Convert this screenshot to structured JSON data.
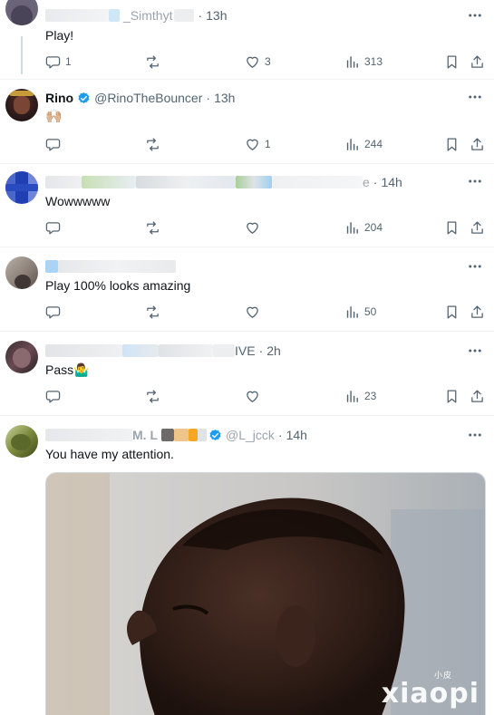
{
  "tweets": [
    {
      "display_name": "",
      "handle": "_Simthyt",
      "time": "13h",
      "text": "Play!",
      "stats": {
        "replies": "1",
        "retweets": "",
        "likes": "3",
        "views": "313"
      }
    },
    {
      "display_name": "Rino",
      "handle": "@RinoTheBouncer",
      "time": "13h",
      "text": "🙌🏼",
      "stats": {
        "replies": "",
        "retweets": "",
        "likes": "1",
        "views": "244"
      }
    },
    {
      "display_name": "",
      "handle": "e",
      "time": "14h",
      "text": "Wowwwww",
      "stats": {
        "replies": "",
        "retweets": "",
        "likes": "",
        "views": "204"
      }
    },
    {
      "display_name": "",
      "handle": "",
      "time": "",
      "text": "Play 100% looks amazing",
      "stats": {
        "replies": "",
        "retweets": "",
        "likes": "",
        "views": "50"
      }
    },
    {
      "display_name": "IVE",
      "handle": "",
      "time": "2h",
      "text": "Pass🤷‍♂️",
      "stats": {
        "replies": "",
        "retweets": "",
        "likes": "",
        "views": "23"
      }
    },
    {
      "display_name": "M. L",
      "handle": "@L_jcck",
      "time": "14h",
      "text": "You have my attention.",
      "stats": {}
    }
  ],
  "watermark": {
    "small": "小皮",
    "main": "xiaopi"
  },
  "colors": {
    "text": "#0f1419",
    "secondary": "#536471",
    "verified": "#1d9bf0",
    "border": "#eff3f4"
  }
}
